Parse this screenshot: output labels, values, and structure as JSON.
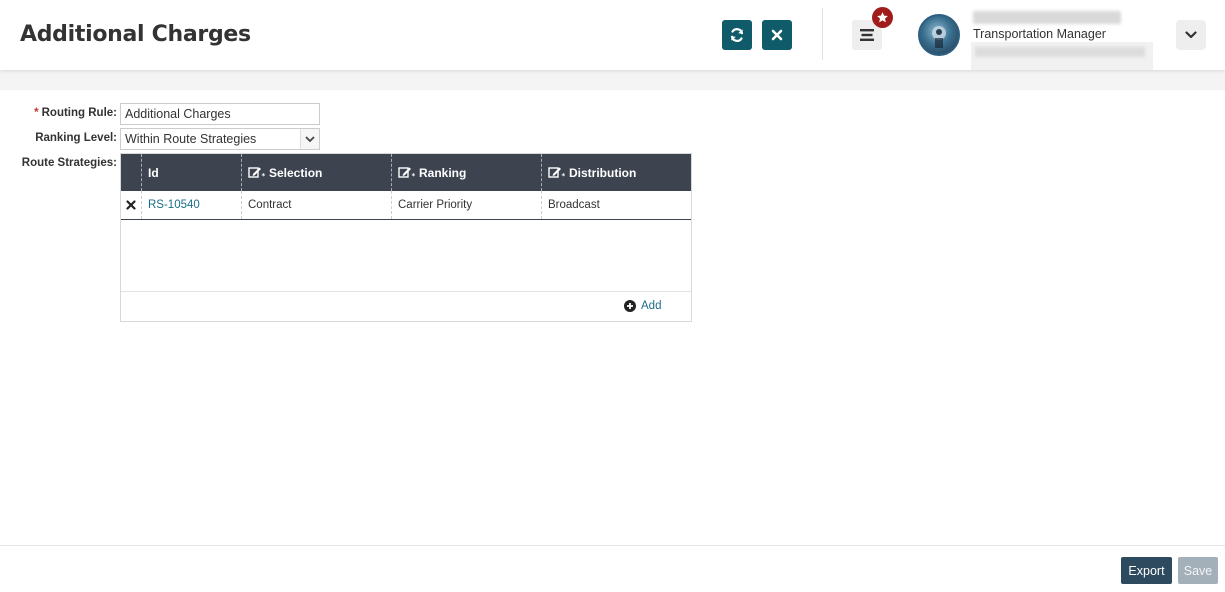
{
  "header": {
    "title": "Additional Charges",
    "refresh_icon": "refresh-icon",
    "close_icon": "close-icon",
    "menu_icon": "hamburger-menu-icon",
    "favorites_icon": "star-badge-icon",
    "user": {
      "role": "Transportation Manager"
    },
    "dropdown_icon": "chevron-down-icon"
  },
  "form": {
    "routing_rule": {
      "required_mark": "*",
      "label": "Routing Rule:",
      "value": "Additional Charges"
    },
    "ranking_level": {
      "label": "Ranking Level:",
      "value": "Within Route Strategies"
    },
    "route_strategies": {
      "label": "Route Strategies:"
    }
  },
  "grid": {
    "columns": [
      "Id",
      "Selection",
      "Ranking",
      "Distribution"
    ],
    "rows": [
      {
        "id": "RS-10540",
        "selection": "Contract",
        "ranking": "Carrier Priority",
        "distribution": "Broadcast"
      }
    ],
    "add_label": "Add"
  },
  "footer": {
    "export_label": "Export",
    "save_label": "Save"
  },
  "colors": {
    "accent": "#0f5b6a",
    "grid_header": "#3d4450",
    "link": "#1b6d8a",
    "badge": "#a01c1c",
    "export_button": "#2e4a5e",
    "save_button_disabled": "#a3b0b9"
  }
}
